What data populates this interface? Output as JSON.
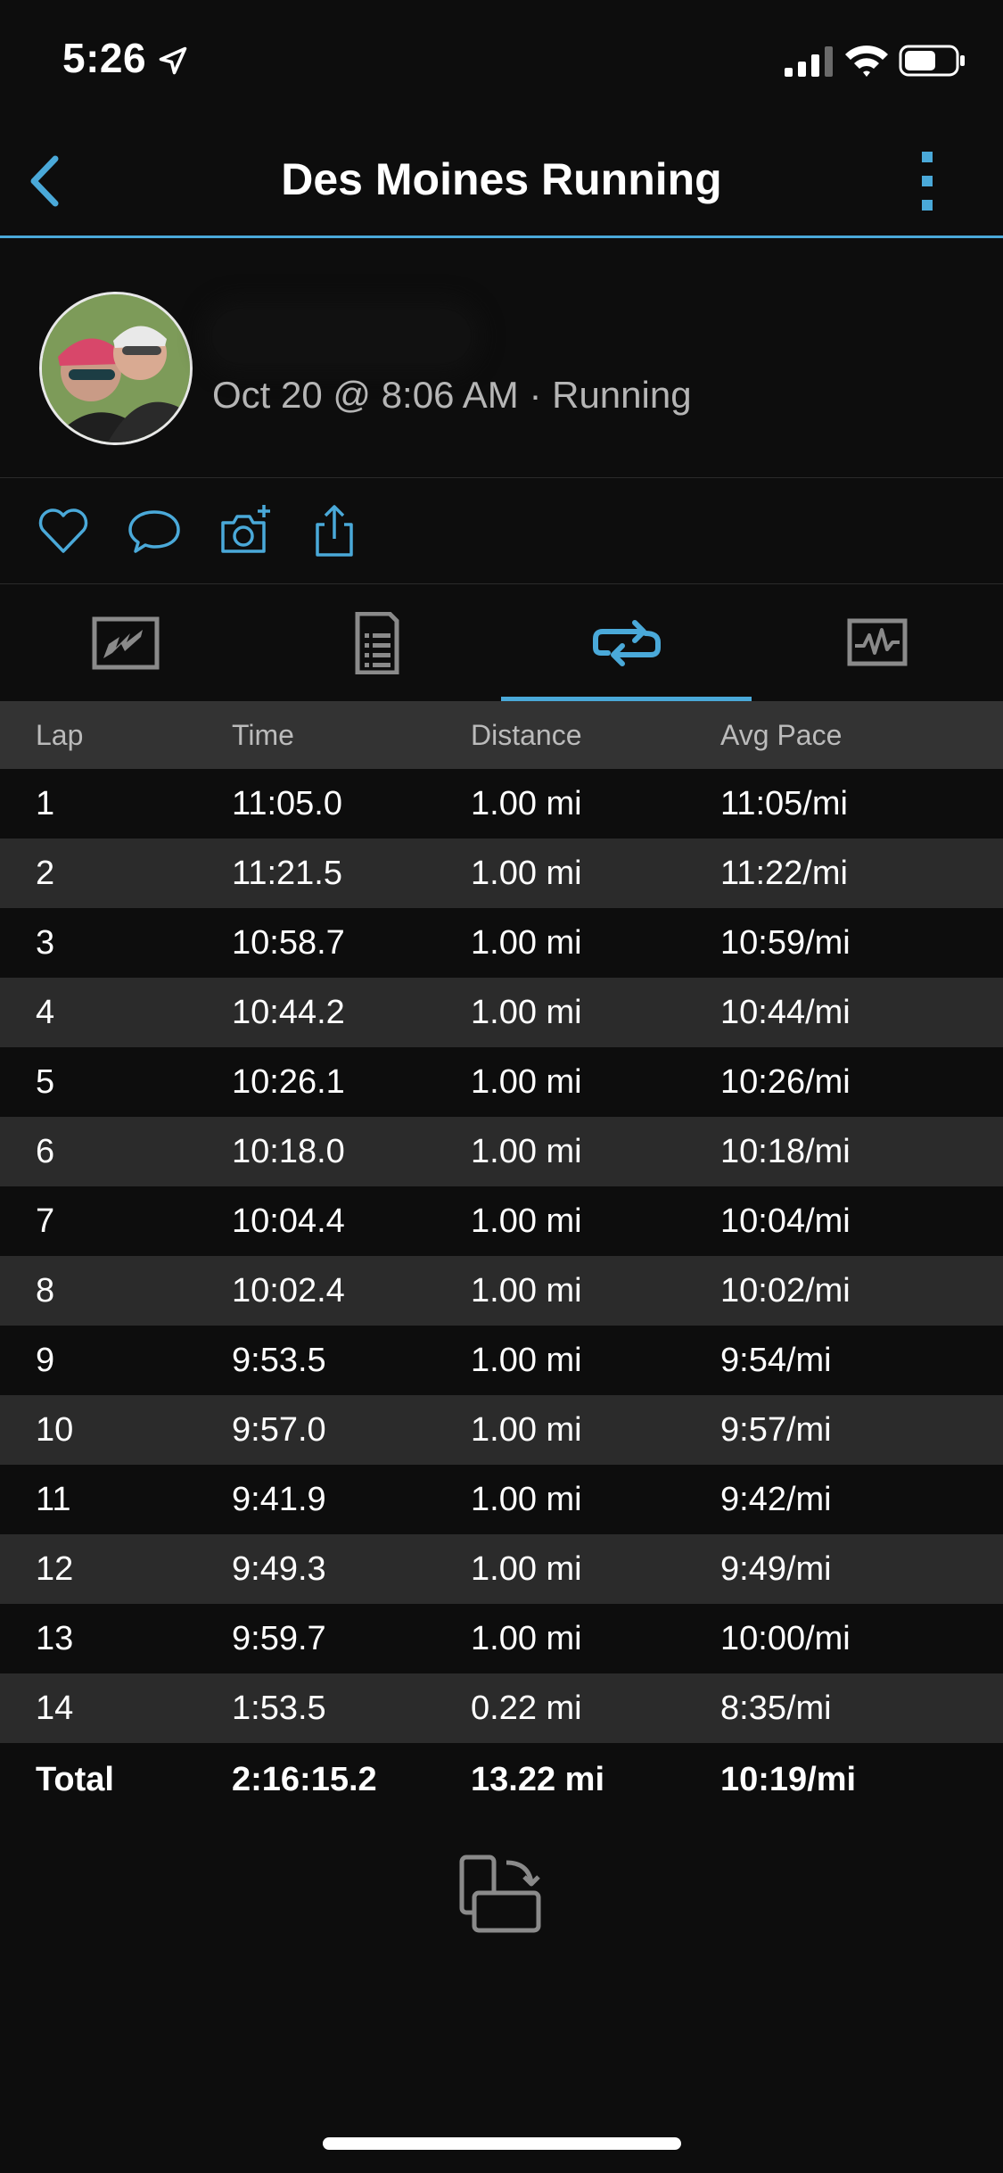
{
  "status_bar": {
    "time": "5:26"
  },
  "header": {
    "title": "Des Moines Running"
  },
  "activity": {
    "meta": "Oct 20 @ 8:06 AM · Running"
  },
  "colors": {
    "accent": "#4aa9d9",
    "background": "#0d0d0d",
    "row_alt": "#2b2b2b",
    "header_row": "#333333"
  },
  "actions": [
    "heart-icon",
    "comment-icon",
    "add-photo-icon",
    "share-icon"
  ],
  "tabs": [
    "map-tab",
    "details-tab",
    "laps-tab",
    "charts-tab"
  ],
  "active_tab": "laps-tab",
  "laps": {
    "columns": [
      "Lap",
      "Time",
      "Distance",
      "Avg Pace"
    ],
    "rows": [
      [
        "1",
        "11:05.0",
        "1.00 mi",
        "11:05/mi"
      ],
      [
        "2",
        "11:21.5",
        "1.00 mi",
        "11:22/mi"
      ],
      [
        "3",
        "10:58.7",
        "1.00 mi",
        "10:59/mi"
      ],
      [
        "4",
        "10:44.2",
        "1.00 mi",
        "10:44/mi"
      ],
      [
        "5",
        "10:26.1",
        "1.00 mi",
        "10:26/mi"
      ],
      [
        "6",
        "10:18.0",
        "1.00 mi",
        "10:18/mi"
      ],
      [
        "7",
        "10:04.4",
        "1.00 mi",
        "10:04/mi"
      ],
      [
        "8",
        "10:02.4",
        "1.00 mi",
        "10:02/mi"
      ],
      [
        "9",
        "9:53.5",
        "1.00 mi",
        "9:54/mi"
      ],
      [
        "10",
        "9:57.0",
        "1.00 mi",
        "9:57/mi"
      ],
      [
        "11",
        "9:41.9",
        "1.00 mi",
        "9:42/mi"
      ],
      [
        "12",
        "9:49.3",
        "1.00 mi",
        "9:49/mi"
      ],
      [
        "13",
        "9:59.7",
        "1.00 mi",
        "10:00/mi"
      ],
      [
        "14",
        "1:53.5",
        "0.22 mi",
        "8:35/mi"
      ]
    ],
    "total": [
      "Total",
      "2:16:15.2",
      "13.22 mi",
      "10:19/mi"
    ]
  }
}
